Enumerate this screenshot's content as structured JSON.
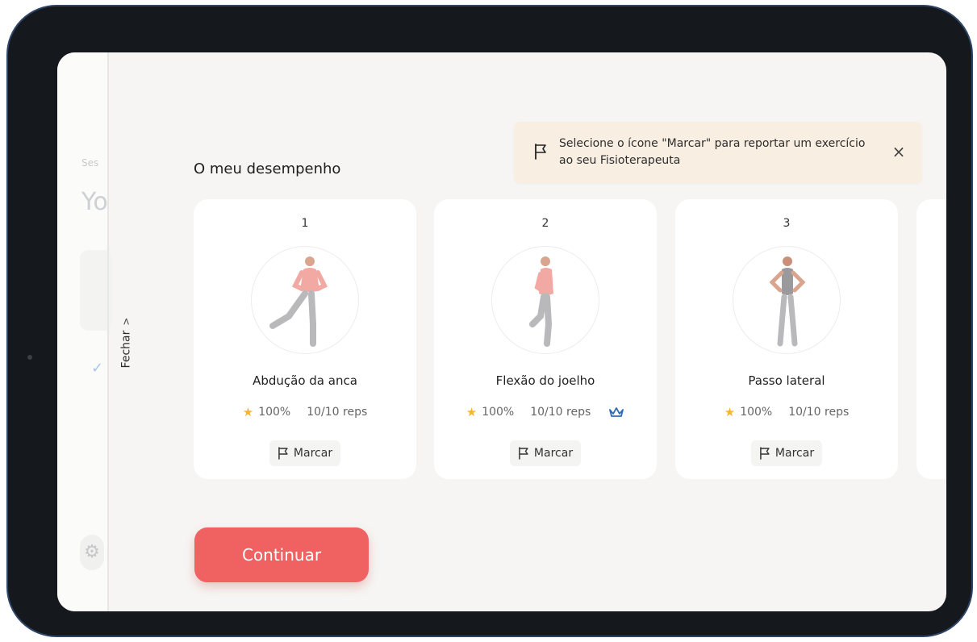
{
  "background_page": {
    "session_label": "Ses",
    "title": "Yo"
  },
  "sidebar": {
    "close_label": "Fechar",
    "close_chevron": ">"
  },
  "panel": {
    "title": "O meu desempenho"
  },
  "toast": {
    "icon": "flag-icon",
    "message": "Selecione o ícone \"Marcar\" para reportar um exercício ao seu Fisioterapeuta",
    "close_icon": "close-icon",
    "close_glyph": "×"
  },
  "exercises": [
    {
      "number": "1",
      "name": "Abdução da anca",
      "score": "100%",
      "reps": "10/10 reps",
      "mark_label": "Marcar",
      "crown": false
    },
    {
      "number": "2",
      "name": "Flexão do joelho",
      "score": "100%",
      "reps": "10/10 reps",
      "mark_label": "Marcar",
      "crown": true
    },
    {
      "number": "3",
      "name": "Passo lateral",
      "score": "100%",
      "reps": "10/10 reps",
      "mark_label": "Marcar",
      "crown": false
    }
  ],
  "continue_button": {
    "label": "Continuar"
  },
  "colors": {
    "accent": "#f06262",
    "star": "#f2b632",
    "crown": "#2f6db5",
    "toast_bg": "#f8efe2",
    "device_frame": "#15181d"
  }
}
